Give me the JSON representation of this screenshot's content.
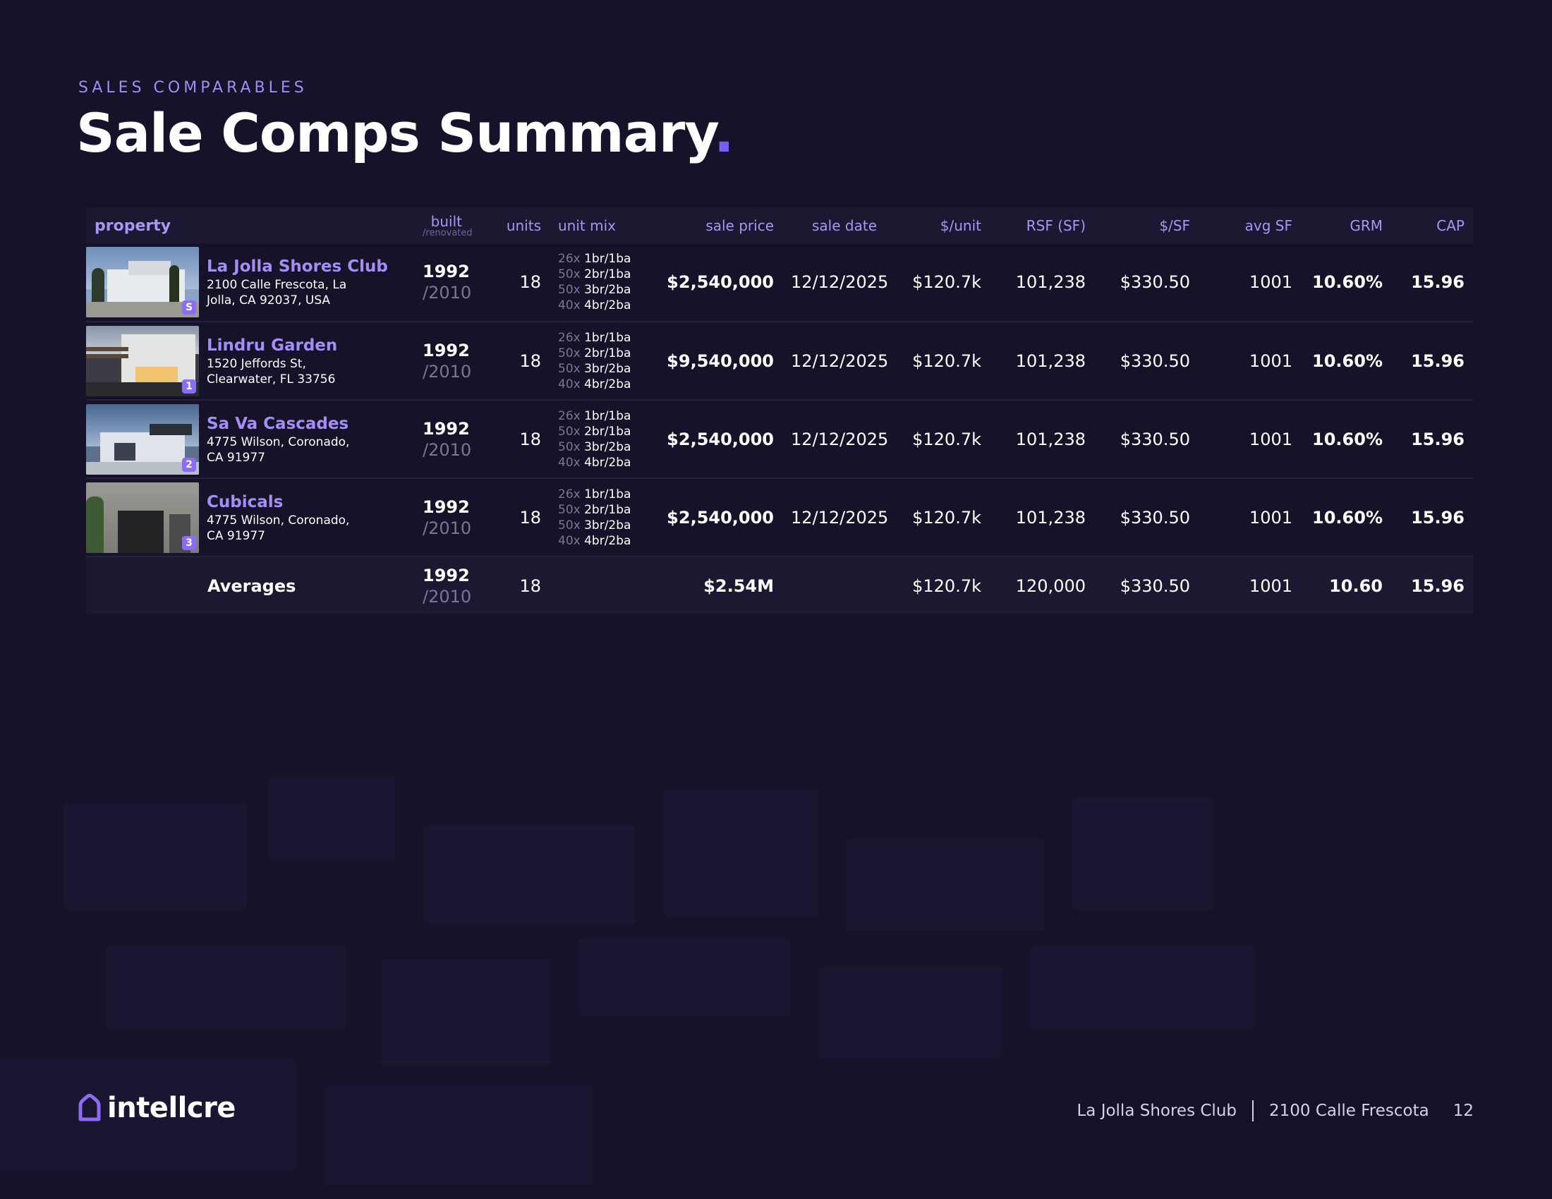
{
  "header": {
    "eyebrow": "SALES COMPARABLES",
    "title": "Sale Comps Summary",
    "title_dot": "."
  },
  "table": {
    "columns": {
      "property": "property",
      "built": "built",
      "built_sub": "/renovated",
      "units": "units",
      "unit_mix": "unit mix",
      "sale_price": "sale price",
      "sale_date": "sale date",
      "per_unit": "$/unit",
      "rsf": "RSF (SF)",
      "per_sf": "$/SF",
      "avg_sf": "avg SF",
      "grm": "GRM",
      "cap": "CAP"
    },
    "rows": [
      {
        "name": "La Jolla Shores Club",
        "address": "2100 Calle Frescota, La Jolla, CA 92037, USA",
        "badge": "S",
        "built": "1992",
        "renovated": "/2010",
        "units": "18",
        "mix": [
          {
            "qty": "26x",
            "type": "1br/1ba"
          },
          {
            "qty": "50x",
            "type": "2br/1ba"
          },
          {
            "qty": "50x",
            "type": "3br/2ba"
          },
          {
            "qty": "40x",
            "type": "4br/2ba"
          }
        ],
        "sale_price": "$2,540,000",
        "sale_date": "12/12/2025",
        "per_unit": "$120.7k",
        "rsf": "101,238",
        "per_sf": "$330.50",
        "avg_sf": "1001",
        "grm": "10.60%",
        "cap": "15.96"
      },
      {
        "name": "Lindru Garden",
        "address": "1520 Jeffords St, Clearwater, FL 33756",
        "badge": "1",
        "built": "1992",
        "renovated": "/2010",
        "units": "18",
        "mix": [
          {
            "qty": "26x",
            "type": "1br/1ba"
          },
          {
            "qty": "50x",
            "type": "2br/1ba"
          },
          {
            "qty": "50x",
            "type": "3br/2ba"
          },
          {
            "qty": "40x",
            "type": "4br/2ba"
          }
        ],
        "sale_price": "$9,540,000",
        "sale_date": "12/12/2025",
        "per_unit": "$120.7k",
        "rsf": "101,238",
        "per_sf": "$330.50",
        "avg_sf": "1001",
        "grm": "10.60%",
        "cap": "15.96"
      },
      {
        "name": "Sa Va Cascades",
        "address": "4775 Wilson, Coronado, CA 91977",
        "badge": "2",
        "built": "1992",
        "renovated": "/2010",
        "units": "18",
        "mix": [
          {
            "qty": "26x",
            "type": "1br/1ba"
          },
          {
            "qty": "50x",
            "type": "2br/1ba"
          },
          {
            "qty": "50x",
            "type": "3br/2ba"
          },
          {
            "qty": "40x",
            "type": "4br/2ba"
          }
        ],
        "sale_price": "$2,540,000",
        "sale_date": "12/12/2025",
        "per_unit": "$120.7k",
        "rsf": "101,238",
        "per_sf": "$330.50",
        "avg_sf": "1001",
        "grm": "10.60%",
        "cap": "15.96"
      },
      {
        "name": "Cubicals",
        "address": "4775 Wilson, Coronado, CA 91977",
        "badge": "3",
        "built": "1992",
        "renovated": "/2010",
        "units": "18",
        "mix": [
          {
            "qty": "26x",
            "type": "1br/1ba"
          },
          {
            "qty": "50x",
            "type": "2br/1ba"
          },
          {
            "qty": "50x",
            "type": "3br/2ba"
          },
          {
            "qty": "40x",
            "type": "4br/2ba"
          }
        ],
        "sale_price": "$2,540,000",
        "sale_date": "12/12/2025",
        "per_unit": "$120.7k",
        "rsf": "101,238",
        "per_sf": "$330.50",
        "avg_sf": "1001",
        "grm": "10.60%",
        "cap": "15.96"
      }
    ],
    "averages": {
      "label": "Averages",
      "built": "1992",
      "renovated": "/2010",
      "units": "18",
      "sale_price": "$2.54M",
      "per_unit": "$120.7k",
      "rsf": "120,000",
      "per_sf": "$330.50",
      "avg_sf": "1001",
      "grm": "10.60",
      "cap": "15.96"
    }
  },
  "footer": {
    "logo_text": "intellcre",
    "property": "La Jolla Shores Club",
    "address": "2100 Calle Frescota",
    "page": "12"
  },
  "colors": {
    "background": "#15122a",
    "accent": "#7a5cf0",
    "header_text": "#a996f2"
  }
}
